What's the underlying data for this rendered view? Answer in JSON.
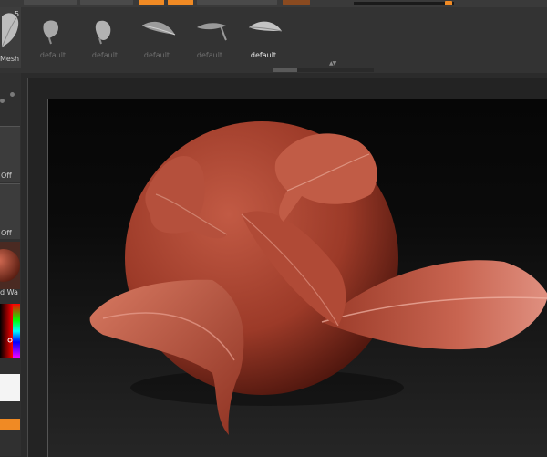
{
  "shelf": {
    "mesh_label": "Mesh",
    "mesh_count": "5",
    "presets": [
      {
        "label": "default",
        "active": false
      },
      {
        "label": "default",
        "active": false
      },
      {
        "label": "default",
        "active": false
      },
      {
        "label": "default",
        "active": false
      },
      {
        "label": "default",
        "active": true
      }
    ]
  },
  "left_panel": {
    "toggle1_label": "Off",
    "toggle2_label": "Off",
    "material_label": "d Wa"
  },
  "colors": {
    "accent": "#f08a24",
    "clay": "#b8503e",
    "background": "#2b2b2b"
  }
}
